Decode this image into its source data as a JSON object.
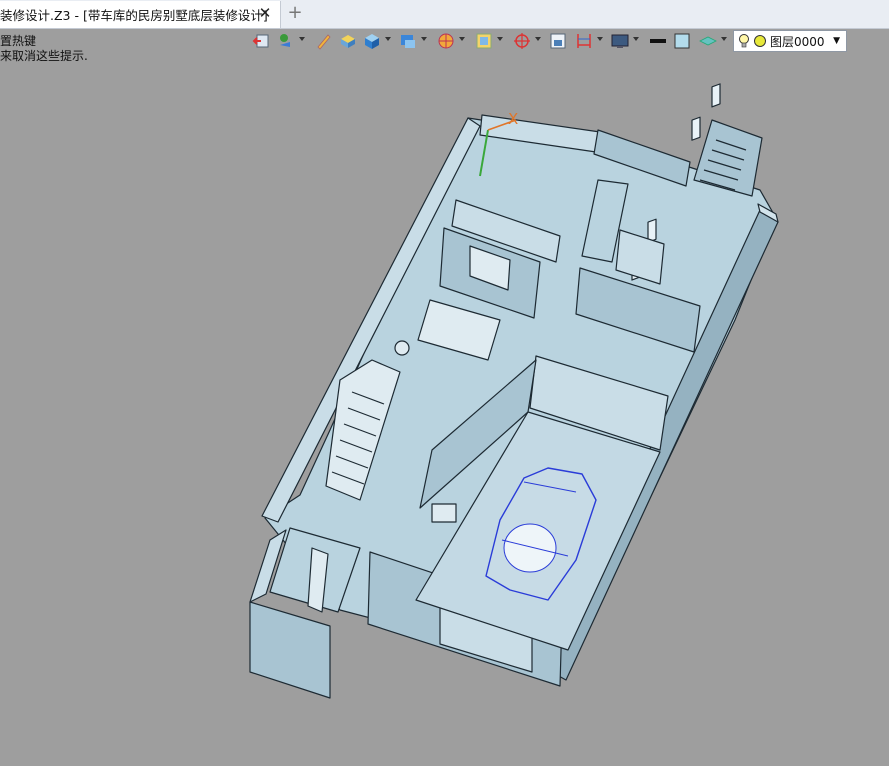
{
  "tab": {
    "title": "装修设计.Z3 - [带车库的民房别墅底层装修设计]",
    "close_icon": "close-icon",
    "add_icon": "plus-icon"
  },
  "hint": {
    "line1": "置热键",
    "line2": "来取消这些提示."
  },
  "toolbar": {
    "icons": [
      "exit-icon",
      "layer-paint-icon",
      "pen-icon",
      "box-icon",
      "cube-icon",
      "render-icon",
      "sphere-icon",
      "frame-icon",
      "axis-icon",
      "window-icon",
      "dimension-icon",
      "monitor-icon",
      "line-style-icon",
      "fill-color-icon",
      "material-icon"
    ],
    "fill_color": "#b3dcec"
  },
  "layer_selector": {
    "value": "图层0000"
  },
  "model": {
    "axis_label": "X",
    "wall_color": "#a8c4d2",
    "floor_color": "#b9d3df",
    "car_color": "#c7dbe6"
  }
}
